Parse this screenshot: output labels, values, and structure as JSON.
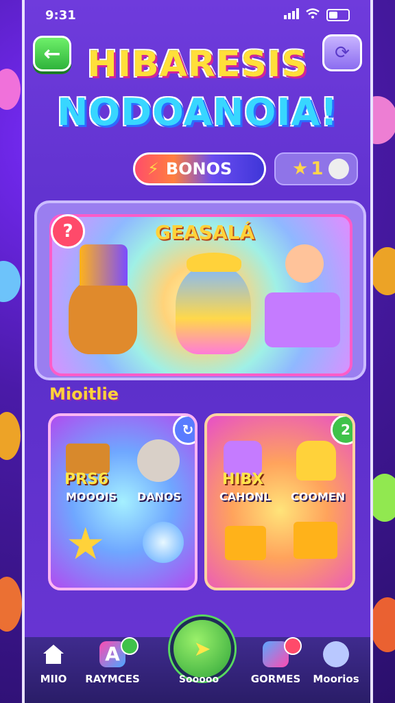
{
  "status_bar": {
    "time": "9:31",
    "signal_icon": "signal-bars-icon",
    "wifi_icon": "wifi-icon",
    "battery_icon": "battery-icon"
  },
  "header": {
    "back_icon": "back-arrow-icon",
    "menu_icon": "refresh-icon",
    "title_line1": "HIBARESIS",
    "title_line2": "NODOANOIA!"
  },
  "bonus": {
    "label": "BONOS",
    "icon": "lightning-icon"
  },
  "stars": {
    "count": "1",
    "icon": "star-icon"
  },
  "featured": {
    "title": "GEASALÁ",
    "help_badge": "?"
  },
  "section": {
    "label": "Mioitlie"
  },
  "cards": [
    {
      "badge": "",
      "tiles": [
        {
          "name": "PRS6",
          "sub": "MOOOIS"
        },
        {
          "name": "",
          "sub": "DANOS"
        }
      ]
    },
    {
      "badge": "2",
      "tiles": [
        {
          "name": "HIBX",
          "sub": "CAHONL"
        },
        {
          "name": "",
          "sub": "COOMEN"
        }
      ]
    }
  ],
  "tabs": [
    {
      "label": "MIIO",
      "icon": "home-icon"
    },
    {
      "label": "RAYMCES",
      "icon": "letter-a-icon"
    },
    {
      "label": "Sooooo",
      "icon": "ticket-icon"
    },
    {
      "label": "GORMES",
      "icon": "rocket-icon"
    },
    {
      "label": "Moorios",
      "icon": "character-icon"
    }
  ],
  "colors": {
    "accent_green": "#2fb33b",
    "accent_pink": "#ff5cc8",
    "title_yellow": "#ffdf3a",
    "title_cyan": "#38d6ff"
  }
}
